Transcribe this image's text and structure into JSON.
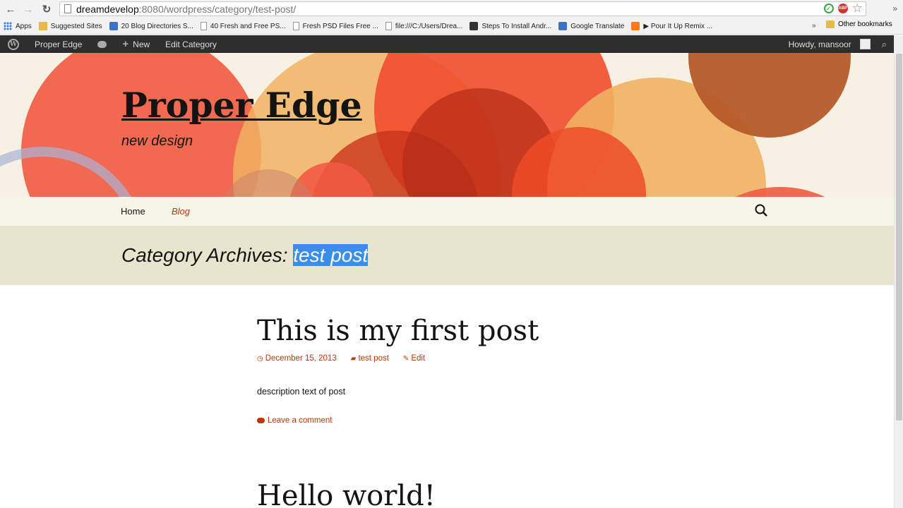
{
  "browser": {
    "url_host": "dreamdevelop",
    "url_rest": ":8080/wordpress/category/test-post/",
    "bookmarks": [
      {
        "label": "Apps",
        "icon": "apps-grid-icon"
      },
      {
        "label": "Suggested Sites",
        "icon": "folder-icon"
      },
      {
        "label": "20 Blog Directories S...",
        "icon": "page-icon"
      },
      {
        "label": "40 Fresh and Free PS...",
        "icon": "page-icon"
      },
      {
        "label": "Fresh PSD Files Free ...",
        "icon": "page-icon"
      },
      {
        "label": "file:///C:/Users/Drea...",
        "icon": "page-icon"
      },
      {
        "label": "Steps To Install Andr...",
        "icon": "site-icon"
      },
      {
        "label": "Google Translate",
        "icon": "translate-icon"
      },
      {
        "label": "▶ Pour It Up Remix ...",
        "icon": "site-icon"
      }
    ],
    "chevron": "»",
    "other_bookmarks": "Other bookmarks",
    "abp_label": "ABP"
  },
  "admin_bar": {
    "site_name": "Proper Edge",
    "new_label": "New",
    "edit_category": "Edit Category",
    "howdy": "Howdy, mansoor"
  },
  "site": {
    "title": "Proper Edge",
    "description": "new design"
  },
  "nav": {
    "items": [
      {
        "label": "Home"
      },
      {
        "label": "Blog"
      }
    ]
  },
  "archive": {
    "prefix": "Category Archives: ",
    "category": "test post"
  },
  "posts": [
    {
      "title": "This is my first post",
      "date": "December 15, 2013",
      "category": "test post",
      "edit": "Edit",
      "body": "description text of post",
      "comment": "Leave a comment"
    },
    {
      "title": "Hello world!"
    }
  ],
  "colors": {
    "accent": "#bc360a",
    "header_bg": "#f6f1e2",
    "nav_bg": "#f7f5e7",
    "archive_bg": "#e8e5ce",
    "admin_bg": "#2e2e2e",
    "selection": "#3b8ee8"
  }
}
